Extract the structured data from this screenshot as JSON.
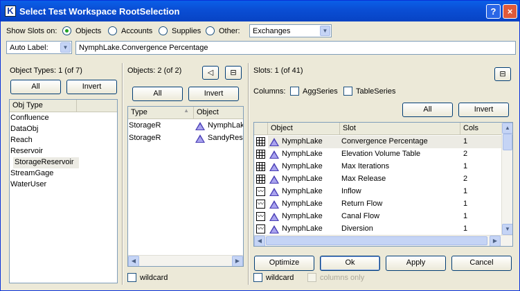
{
  "window": {
    "title": "Select Test Workspace RootSelection",
    "help": "?",
    "close": "×",
    "app_icon": "K"
  },
  "show_slots": {
    "label": "Show Slots on:",
    "options": [
      "Objects",
      "Accounts",
      "Supplies",
      "Other:"
    ],
    "selected": "Objects",
    "other_value": "Exchanges"
  },
  "auto_label": {
    "value": "Auto Label:",
    "text": "NymphLake.Convergence Percentage"
  },
  "object_types": {
    "title": "Object Types: 1 (of 7)",
    "all_label": "All",
    "invert_label": "Invert",
    "header": "Obj Type",
    "items": [
      "Confluence",
      "DataObj",
      "Reach",
      "Reservoir",
      "StorageReservoir",
      "StreamGage",
      "WaterUser"
    ],
    "selected": "StorageReservoir"
  },
  "objects": {
    "title": "Objects: 2 (of 2)",
    "all_label": "All",
    "invert_label": "Invert",
    "headers": [
      "Type",
      "Object"
    ],
    "rows": [
      {
        "type": "StorageR",
        "object": "NymphLak"
      },
      {
        "type": "StorageR",
        "object": "SandyRese"
      }
    ],
    "wildcard_label": "wildcard"
  },
  "slots": {
    "title": "Slots: 1 (of 41)",
    "columns_label": "Columns:",
    "aggseries_label": "AggSeries",
    "tableseries_label": "TableSeries",
    "all_label": "All",
    "invert_label": "Invert",
    "headers": [
      "Object",
      "Slot",
      "Cols"
    ],
    "rows": [
      {
        "icon": "table",
        "object": "NymphLake",
        "slot": "Convergence Percentage",
        "cols": "1"
      },
      {
        "icon": "table",
        "object": "NymphLake",
        "slot": "Elevation Volume Table",
        "cols": "2"
      },
      {
        "icon": "table",
        "object": "NymphLake",
        "slot": "Max Iterations",
        "cols": "1"
      },
      {
        "icon": "table",
        "object": "NymphLake",
        "slot": "Max Release",
        "cols": "2"
      },
      {
        "icon": "series",
        "object": "NymphLake",
        "slot": "Inflow",
        "cols": "1"
      },
      {
        "icon": "series",
        "object": "NymphLake",
        "slot": "Return Flow",
        "cols": "1"
      },
      {
        "icon": "series",
        "object": "NymphLake",
        "slot": "Canal Flow",
        "cols": "1"
      },
      {
        "icon": "series",
        "object": "NymphLake",
        "slot": "Diversion",
        "cols": "1"
      }
    ],
    "wildcard_label": "wildcard",
    "columns_only_label": "columns only"
  },
  "buttons": {
    "optimize": "Optimize",
    "ok": "Ok",
    "apply": "Apply",
    "cancel": "Cancel"
  }
}
